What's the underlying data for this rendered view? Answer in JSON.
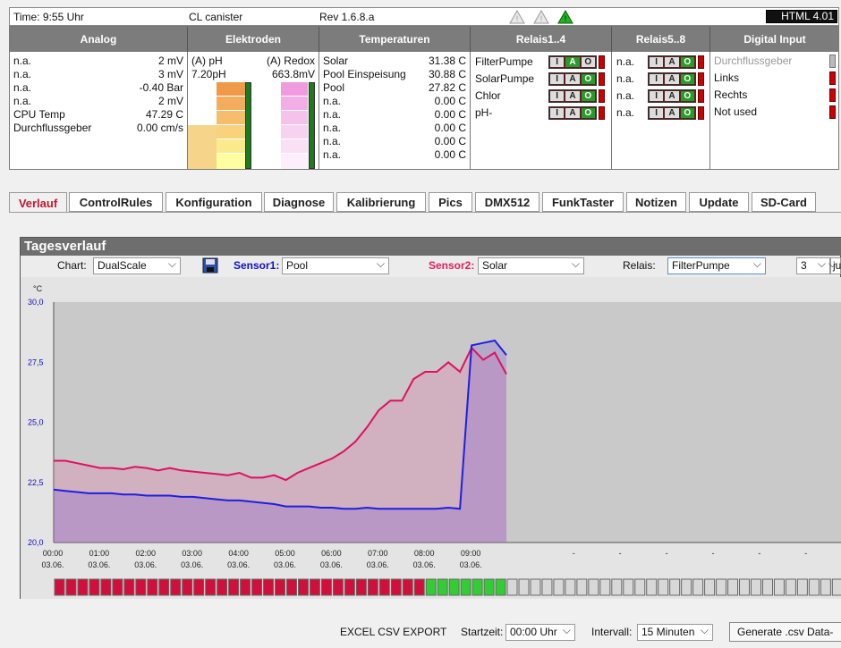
{
  "topbar": {
    "time": "Time: 9:55 Uhr",
    "device": "CL canister",
    "rev": "Rev 1.6.8.a",
    "badge": "HTML 4.01"
  },
  "panel": {
    "headers": [
      "Analog",
      "Elektroden",
      "Temperaturen",
      "Relais1..4",
      "Relais5..8",
      "Digital Input"
    ],
    "analog": [
      {
        "label": "n.a.",
        "value": "2 mV"
      },
      {
        "label": "n.a.",
        "value": "3 mV"
      },
      {
        "label": "n.a.",
        "value": "-0.40 Bar"
      },
      {
        "label": "n.a.",
        "value": "2 mV"
      },
      {
        "label": "CPU Temp",
        "value": "47.29 C"
      },
      {
        "label": "Durchflussgeber",
        "value": "0.00 cm/s"
      }
    ],
    "electrodes": {
      "ph_label": "(A) pH",
      "ph_value": "7.20pH",
      "redox_label": "(A) Redox",
      "redox_value": "663.8mV"
    },
    "temperatures": [
      {
        "label": "Solar",
        "value": "31.38 C"
      },
      {
        "label": "Pool Einspeisung",
        "value": "30.88 C"
      },
      {
        "label": "Pool",
        "value": "27.82 C"
      },
      {
        "label": "n.a.",
        "value": "0.00 C"
      },
      {
        "label": "n.a.",
        "value": "0.00 C"
      },
      {
        "label": "n.a.",
        "value": "0.00 C"
      },
      {
        "label": "n.a.",
        "value": "0.00 C"
      },
      {
        "label": "n.a.",
        "value": "0.00 C"
      }
    ],
    "relais1": [
      {
        "label": "FilterPumpe",
        "active": "A"
      },
      {
        "label": "SolarPumpe",
        "active": "O"
      },
      {
        "label": "Chlor",
        "active": "O"
      },
      {
        "label": "pH-",
        "active": "O"
      }
    ],
    "relais2": [
      {
        "label": "n.a.",
        "active": "O"
      },
      {
        "label": "n.a.",
        "active": "O"
      },
      {
        "label": "n.a.",
        "active": "O"
      },
      {
        "label": "n.a.",
        "active": "O"
      }
    ],
    "iao_letters": [
      "I",
      "A",
      "O"
    ],
    "digital": [
      {
        "label": "Durchflussgeber",
        "disabled": true
      },
      {
        "label": "Links",
        "disabled": false
      },
      {
        "label": "Rechts",
        "disabled": false
      },
      {
        "label": "Not used",
        "disabled": false
      }
    ]
  },
  "tabs": [
    "Verlauf",
    "ControlRules",
    "Konfiguration",
    "Diagnose",
    "Kalibrierung",
    "Pics",
    "DMX512",
    "FunkTaster",
    "Notizen",
    "Update",
    "SD-Card"
  ],
  "tagesverlauf": {
    "title": "Tagesverlauf",
    "chart_label": "Chart:",
    "chart_value": "DualScale",
    "sensor1_label": "Sensor1:",
    "sensor1_value": "Pool",
    "sensor2_label": "Sensor2:",
    "sensor2_value": "Solar",
    "relais_label": "Relais:",
    "relais_value": "FilterPumpe",
    "days_value": "3",
    "extra_value": "ju"
  },
  "chart_data": {
    "type": "line",
    "ylabel": "°C",
    "ylim": [
      20.0,
      30.0
    ],
    "yticks": [
      "30,0",
      "27,5",
      "25,0",
      "22,5",
      "20,0"
    ],
    "x_hours": [
      0,
      0.5,
      1,
      1.5,
      2,
      2.5,
      3,
      3.5,
      4,
      4.5,
      5,
      5.5,
      6,
      6.5,
      7,
      7.5,
      8,
      8.5,
      9,
      9.5
    ],
    "xticks": [
      {
        "time": "00:00",
        "date": "03.06."
      },
      {
        "time": "01:00",
        "date": "03.06."
      },
      {
        "time": "02:00",
        "date": "03.06."
      },
      {
        "time": "03:00",
        "date": "03.06."
      },
      {
        "time": "04:00",
        "date": "03.06."
      },
      {
        "time": "05:00",
        "date": "03.06."
      },
      {
        "time": "06:00",
        "date": "03.06."
      },
      {
        "time": "07:00",
        "date": "03.06."
      },
      {
        "time": "08:00",
        "date": "03.06."
      },
      {
        "time": "09:00",
        "date": "03.06."
      }
    ],
    "dash_ticks": [
      "-",
      "-",
      "-",
      "-",
      "-",
      "-",
      "-"
    ],
    "series": [
      {
        "name": "Pool",
        "color": "#1f1fe0",
        "x": [
          0,
          0.25,
          0.5,
          0.75,
          1,
          1.25,
          1.5,
          1.75,
          2,
          2.25,
          2.5,
          2.75,
          3,
          3.25,
          3.5,
          3.75,
          4,
          4.25,
          4.5,
          4.75,
          5,
          5.25,
          5.5,
          5.75,
          6,
          6.25,
          6.5,
          6.75,
          7,
          7.25,
          7.5,
          7.75,
          8,
          8.25,
          8.5,
          8.75,
          9,
          9.25,
          9.5,
          9.75
        ],
        "values": [
          22.2,
          22.15,
          22.1,
          22.05,
          22.05,
          22.05,
          22.0,
          22.0,
          21.95,
          21.95,
          21.95,
          21.9,
          21.9,
          21.85,
          21.8,
          21.75,
          21.75,
          21.7,
          21.65,
          21.6,
          21.5,
          21.5,
          21.5,
          21.45,
          21.45,
          21.4,
          21.4,
          21.45,
          21.4,
          21.4,
          21.4,
          21.4,
          21.4,
          21.4,
          21.45,
          21.4,
          28.2,
          28.3,
          28.4,
          27.8
        ]
      },
      {
        "name": "Solar",
        "color": "#e01060",
        "x": [
          0,
          0.25,
          0.5,
          0.75,
          1,
          1.25,
          1.5,
          1.75,
          2,
          2.25,
          2.5,
          2.75,
          3,
          3.25,
          3.5,
          3.75,
          4,
          4.25,
          4.5,
          4.75,
          5,
          5.25,
          5.5,
          5.75,
          6,
          6.25,
          6.5,
          6.75,
          7,
          7.25,
          7.5,
          7.75,
          8,
          8.25,
          8.5,
          8.75,
          9,
          9.25,
          9.5,
          9.75
        ],
        "values": [
          23.4,
          23.4,
          23.3,
          23.2,
          23.1,
          23.1,
          23.05,
          23.15,
          23.1,
          23.0,
          23.1,
          23.0,
          22.95,
          22.9,
          22.85,
          22.8,
          22.9,
          22.7,
          22.7,
          22.8,
          22.6,
          22.9,
          23.1,
          23.3,
          23.5,
          23.8,
          24.2,
          24.8,
          25.5,
          25.9,
          25.9,
          26.8,
          27.1,
          27.1,
          27.5,
          27.1,
          28.1,
          27.6,
          27.9,
          27.0
        ]
      }
    ],
    "relais_timeline": {
      "red_until_hours": 8.0,
      "green_until_hours": 9.75
    }
  },
  "export": {
    "title": "EXCEL CSV EXPORT",
    "start_label": "Startzeit:",
    "start_value": "00:00 Uhr",
    "interval_label": "Intervall:",
    "interval_value": "15 Minuten",
    "button": "Generate .csv Data-"
  }
}
